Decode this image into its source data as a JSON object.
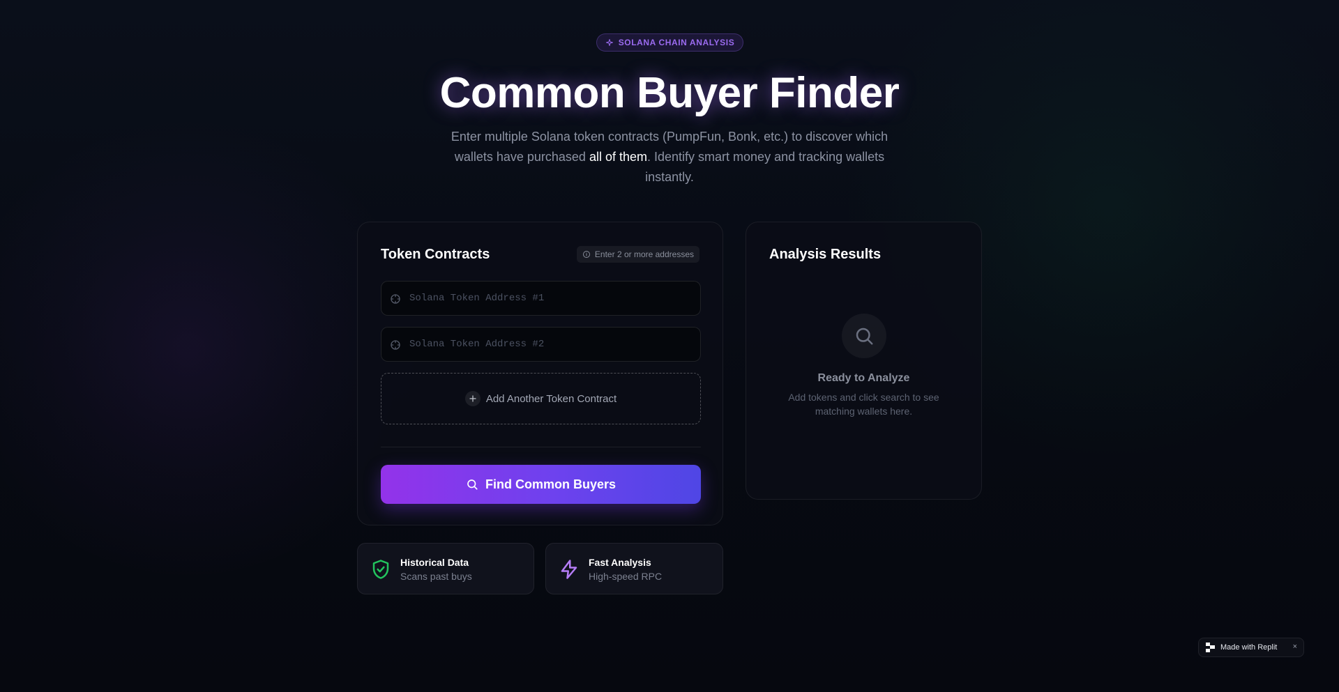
{
  "badge": {
    "label": "SOLANA CHAIN ANALYSIS",
    "icon": "sparkle-icon"
  },
  "hero": {
    "title": "Common Buyer Finder",
    "subtitle_before": "Enter multiple Solana token contracts (PumpFun, Bonk, etc.) to discover which wallets have purchased ",
    "subtitle_emphasis": "all of them",
    "subtitle_after": ". Identify smart money and tracking wallets instantly."
  },
  "token_card": {
    "title": "Token Contracts",
    "hint": "Enter 2 or more addresses",
    "inputs": [
      {
        "placeholder": "Solana Token Address #1",
        "value": ""
      },
      {
        "placeholder": "Solana Token Address #2",
        "value": ""
      }
    ],
    "add_label": "Add Another Token Contract",
    "submit_label": "Find Common Buyers"
  },
  "results_card": {
    "title": "Analysis Results",
    "empty_title": "Ready to Analyze",
    "empty_text": "Add tokens and click search to see matching wallets here."
  },
  "features": [
    {
      "title": "Historical Data",
      "subtitle": "Scans past buys",
      "icon": "shield-check-icon"
    },
    {
      "title": "Fast Analysis",
      "subtitle": "High-speed RPC",
      "icon": "lightning-icon"
    }
  ],
  "replit_badge": {
    "label": "Made with Replit",
    "close": "×"
  },
  "colors": {
    "accent_purple": "#9333ea",
    "accent_indigo": "#4f46e5",
    "success_green": "#22c55e",
    "badge_purple": "#9b6bf0"
  }
}
